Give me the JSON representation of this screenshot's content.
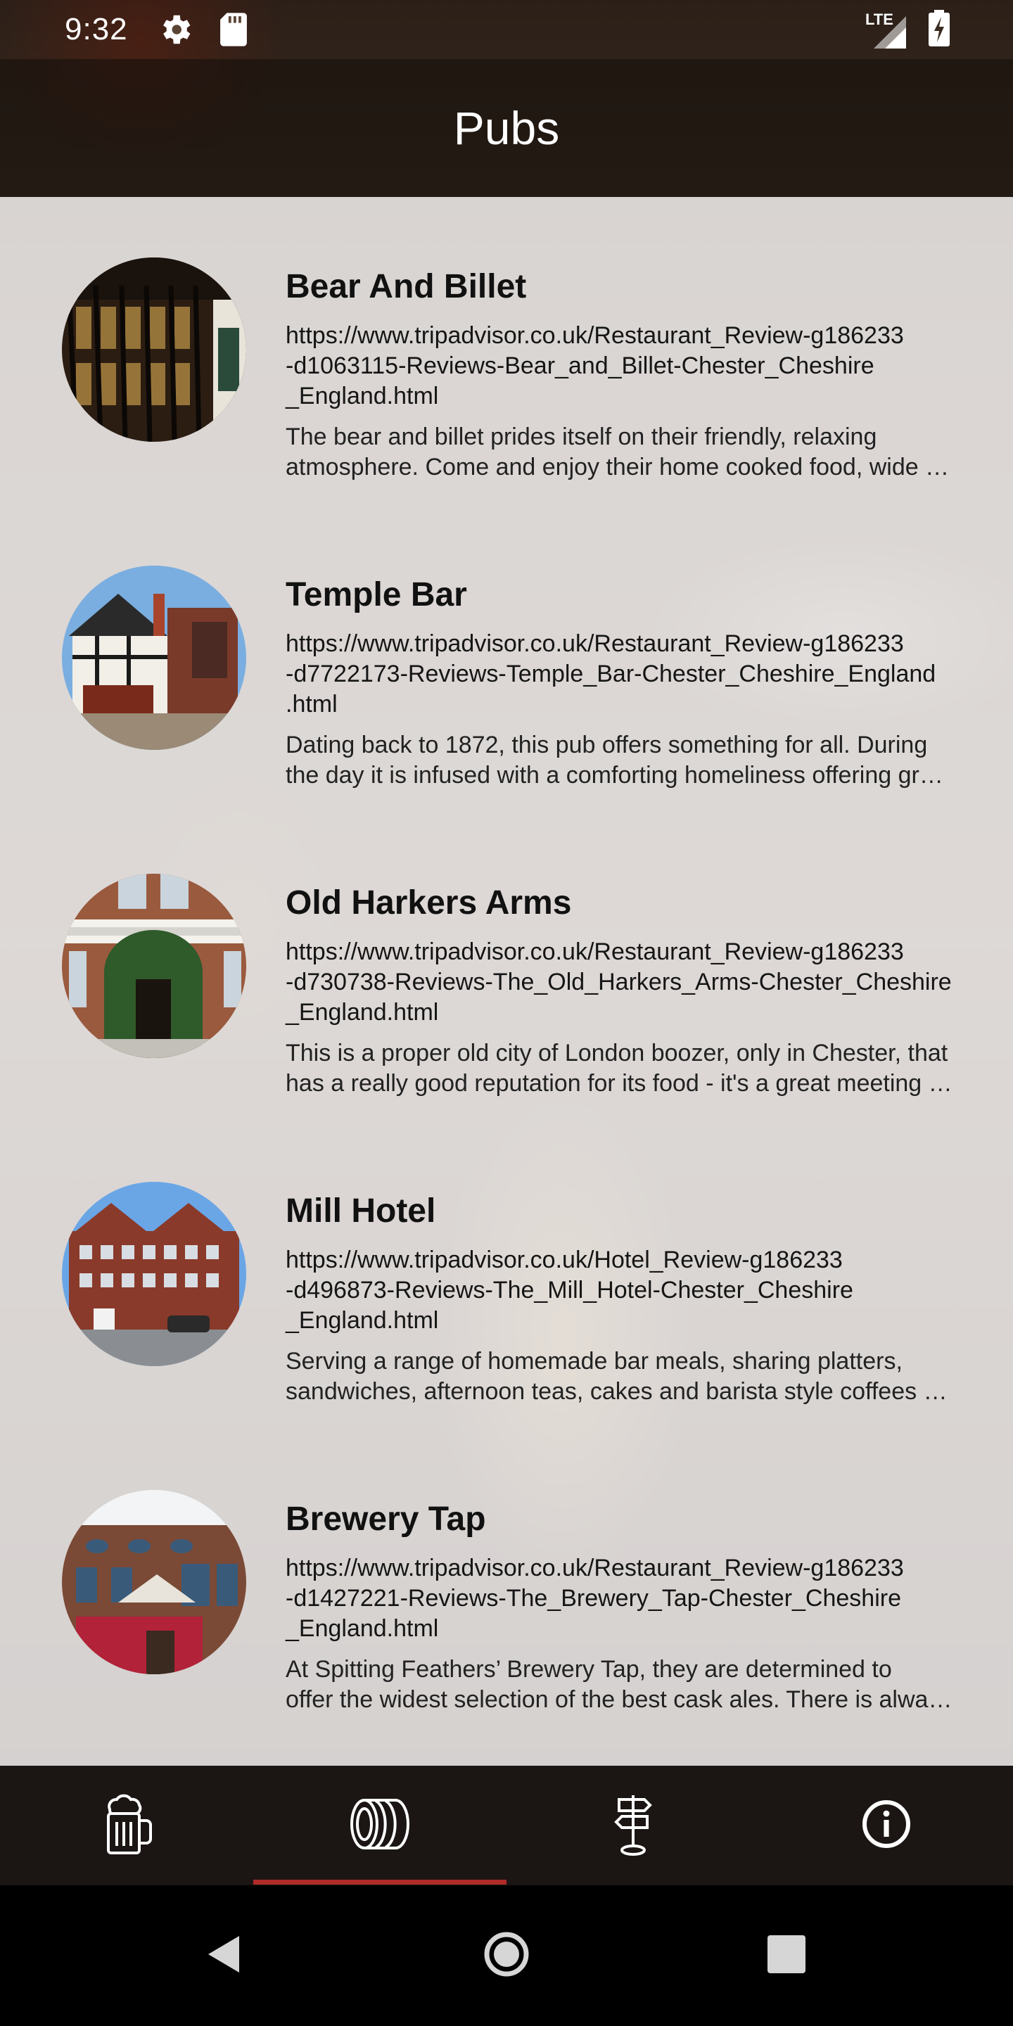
{
  "status_bar": {
    "time": "9:32",
    "network": "LTE"
  },
  "app_bar": {
    "title": "Pubs"
  },
  "pubs": [
    {
      "name": "Bear And Billet",
      "url": "https://www.tripadvisor.co.uk/Restaurant_Review-g186233-d1063115-Reviews-Bear_and_Billet-Chester_Cheshire_England.html",
      "url_lines": [
        "https://www.tripadvisor.co.uk/Restaurant_Review-g186233",
        "-d1063115-Reviews-Bear_and_Billet-Chester_Cheshire",
        "_England.html"
      ],
      "desc_lines": [
        "The bear and billet prides itself on their friendly, relaxing",
        "atmosphere. Come and enjoy their home cooked food, wide s…"
      ]
    },
    {
      "name": "Temple Bar",
      "url_lines": [
        "https://www.tripadvisor.co.uk/Restaurant_Review-g186233",
        "-d7722173-Reviews-Temple_Bar-Chester_Cheshire_England",
        ".html"
      ],
      "desc_lines": [
        "Dating back to 1872, this pub offers something for all. During",
        "the day it is infused with a comforting homeliness offering gr…"
      ]
    },
    {
      "name": "Old Harkers Arms",
      "url_lines": [
        "https://www.tripadvisor.co.uk/Restaurant_Review-g186233",
        "-d730738-Reviews-The_Old_Harkers_Arms-Chester_Cheshire",
        "_England.html"
      ],
      "desc_lines": [
        "This is a proper old city of London boozer, only in Chester, that",
        "has a really good reputation for its food - it's a great meeting …"
      ]
    },
    {
      "name": "Mill Hotel",
      "url_lines": [
        "https://www.tripadvisor.co.uk/Hotel_Review-g186233",
        "-d496873-Reviews-The_Mill_Hotel-Chester_Cheshire",
        "_England.html"
      ],
      "desc_lines": [
        "Serving a range of homemade bar meals, sharing platters,",
        "sandwiches, afternoon teas, cakes and barista style coffees fr…"
      ]
    },
    {
      "name": "Brewery Tap",
      "url_lines": [
        "https://www.tripadvisor.co.uk/Restaurant_Review-g186233",
        "-d1427221-Reviews-The_Brewery_Tap-Chester_Cheshire",
        "_England.html"
      ],
      "desc_lines": [
        "At Spitting Feathers’ Brewery Tap, they are determined to",
        "offer the widest selection of the best cask ales. There is alwa…"
      ]
    }
  ],
  "bottom_nav": {
    "items": [
      {
        "icon": "beer-mug-icon"
      },
      {
        "icon": "barrel-icon",
        "selected": true
      },
      {
        "icon": "signpost-icon"
      },
      {
        "icon": "info-icon"
      }
    ],
    "accent_color": "#b02a2a"
  },
  "system_nav": {
    "buttons": [
      "back-icon",
      "home-icon",
      "recents-icon"
    ]
  }
}
